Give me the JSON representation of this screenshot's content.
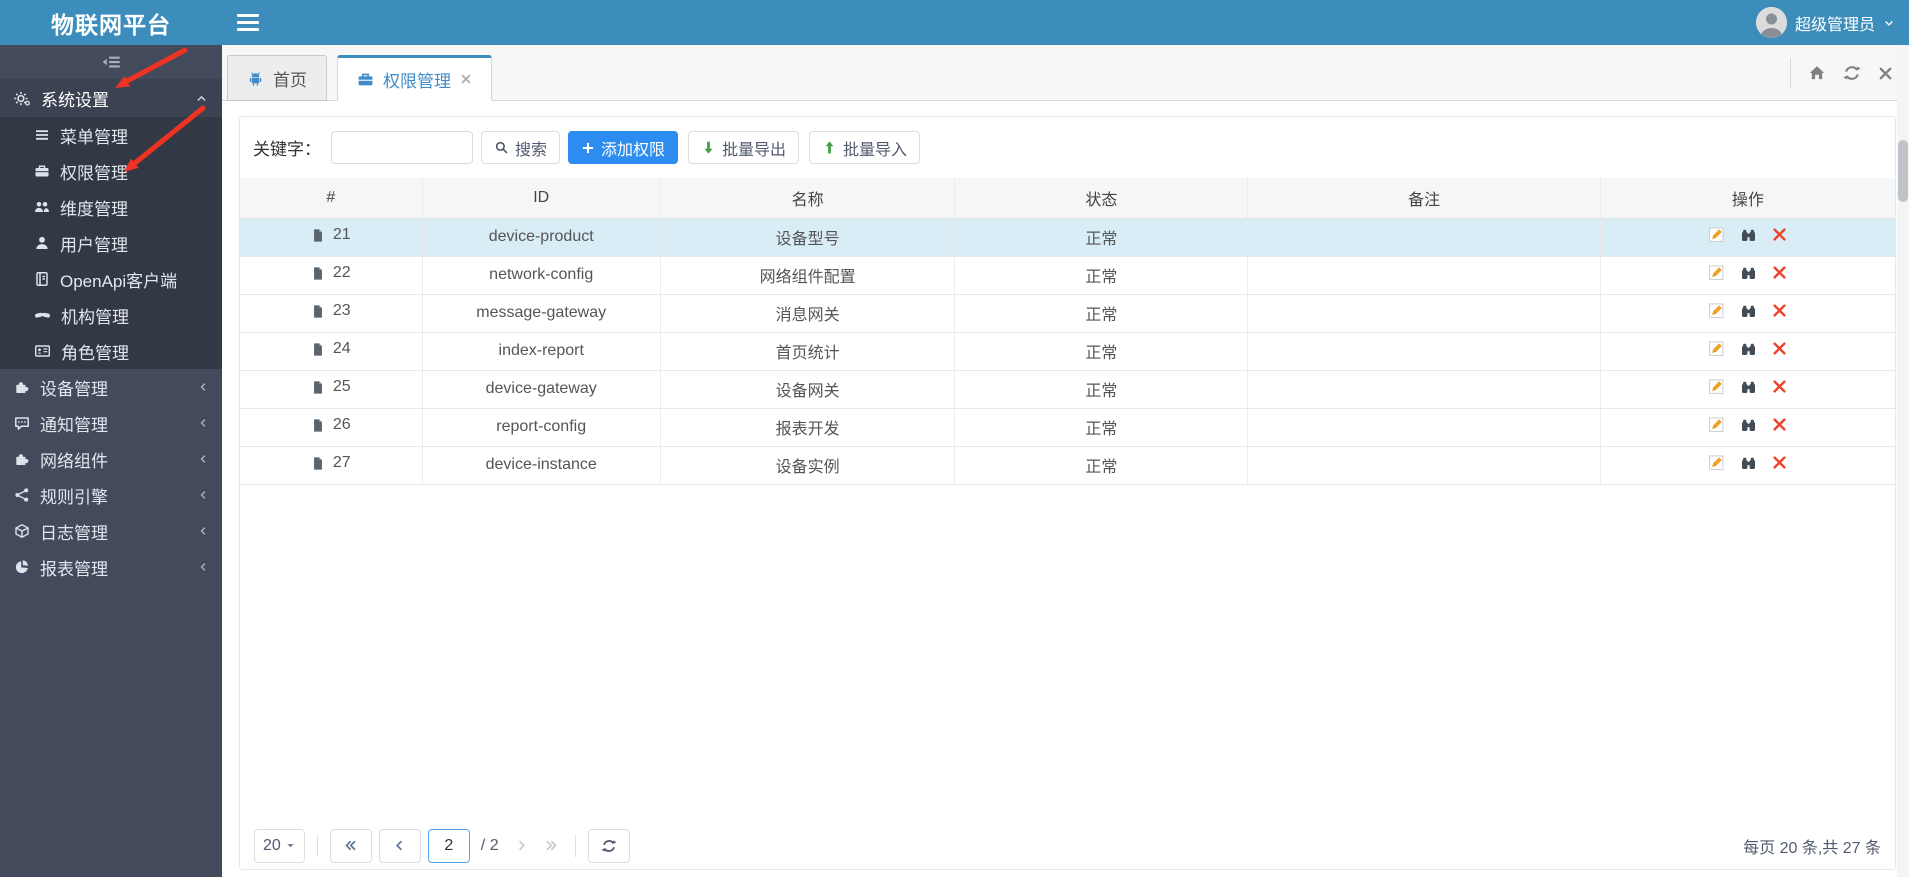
{
  "app": {
    "title": "物联网平台",
    "user_name": "超级管理员"
  },
  "sidebar": {
    "active_group": {
      "label": "系统设置"
    },
    "system_items": [
      {
        "label": "菜单管理"
      },
      {
        "label": "权限管理"
      },
      {
        "label": "维度管理"
      },
      {
        "label": "用户管理"
      },
      {
        "label": "OpenApi客户端"
      },
      {
        "label": "机构管理"
      },
      {
        "label": "角色管理"
      }
    ],
    "groups": [
      {
        "label": "设备管理"
      },
      {
        "label": "通知管理"
      },
      {
        "label": "网络组件"
      },
      {
        "label": "规则引擎"
      },
      {
        "label": "日志管理"
      },
      {
        "label": "报表管理"
      }
    ]
  },
  "tabs": {
    "home": {
      "label": "首页"
    },
    "active": {
      "label": "权限管理"
    }
  },
  "toolbar": {
    "keyword_label": "关键字：",
    "keyword_value": "",
    "search_label": "搜索",
    "add_label": "添加权限",
    "export_label": "批量导出",
    "import_label": "批量导入"
  },
  "table": {
    "headers": [
      "#",
      "ID",
      "名称",
      "状态",
      "备注",
      "操作"
    ],
    "rows": [
      {
        "num": "21",
        "id": "device-product",
        "name": "设备型号",
        "status": "正常",
        "remark": ""
      },
      {
        "num": "22",
        "id": "network-config",
        "name": "网络组件配置",
        "status": "正常",
        "remark": ""
      },
      {
        "num": "23",
        "id": "message-gateway",
        "name": "消息网关",
        "status": "正常",
        "remark": ""
      },
      {
        "num": "24",
        "id": "index-report",
        "name": "首页统计",
        "status": "正常",
        "remark": ""
      },
      {
        "num": "25",
        "id": "device-gateway",
        "name": "设备网关",
        "status": "正常",
        "remark": ""
      },
      {
        "num": "26",
        "id": "report-config",
        "name": "报表开发",
        "status": "正常",
        "remark": ""
      },
      {
        "num": "27",
        "id": "device-instance",
        "name": "设备实例",
        "status": "正常",
        "remark": ""
      }
    ]
  },
  "pagination": {
    "page_size": "20",
    "current_page": "2",
    "total_label": "/ 2",
    "summary": "每页 20 条,共 27 条"
  },
  "colors": {
    "header_blue": "#3c8dbc",
    "primary_button": "#2d8cf0",
    "active_tab_text": "#418bca",
    "selected_row_bg": "#d9edf7",
    "sidebar_bg": "#434a5c",
    "submenu_bg": "#333845",
    "export_green": "#43a047",
    "delete_red": "#e8442e",
    "annotation_red": "#ee3322"
  }
}
